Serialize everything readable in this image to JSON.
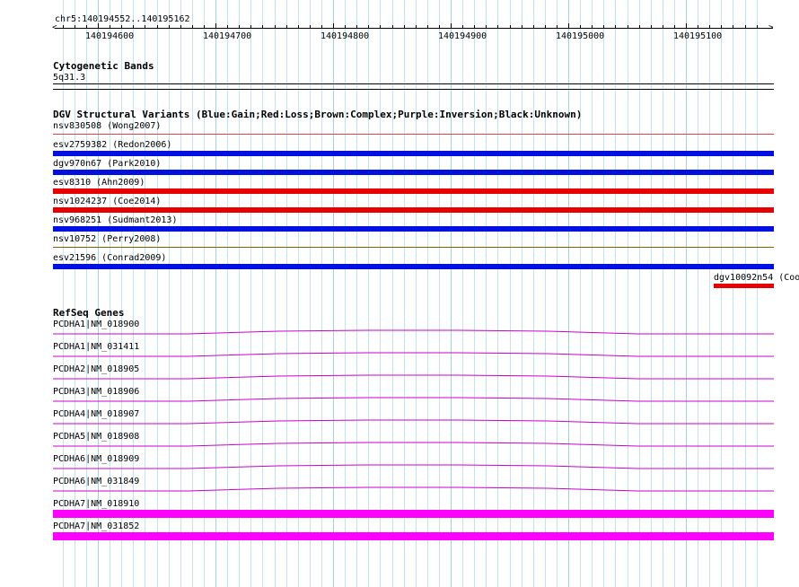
{
  "ruler": {
    "range_label": "chr5:140194552..140195162",
    "ticks": [
      "140194600",
      "140194700",
      "140194800",
      "140194900",
      "140195000",
      "140195100"
    ]
  },
  "cytoband": {
    "title": "Cytogenetic Bands",
    "band": "5q31.3"
  },
  "dgv": {
    "title": "DGV Structural Variants (Blue:Gain;Red:Loss;Brown:Complex;Purple:Inversion;Black:Unknown)",
    "variants": [
      {
        "label": "nsv830508 (Wong2007)",
        "color": "#e04040",
        "kind": "thin"
      },
      {
        "label": "esv2759382 (Redon2006)",
        "color": "#0010e0",
        "kind": "thick"
      },
      {
        "label": "dgv970n67 (Park2010)",
        "color": "#0010e0",
        "kind": "thick"
      },
      {
        "label": "esv8310 (Ahn2009)",
        "color": "#e80000",
        "kind": "thick"
      },
      {
        "label": "nsv1024237 (Coe2014)",
        "color": "#e80000",
        "kind": "thick"
      },
      {
        "label": "nsv968251 (Sudmant2013)",
        "color": "#0010e0",
        "kind": "thick"
      },
      {
        "label": "nsv10752 (Perry2008)",
        "color": "#806000",
        "kind": "thin"
      },
      {
        "label": "esv21596 (Conrad2009)",
        "color": "#0010e0",
        "kind": "thick"
      }
    ],
    "edge_variant": {
      "label": "dgv10092n54 (Coo",
      "color": "#e80000"
    }
  },
  "refseq": {
    "title": "RefSeq Genes",
    "color": "#cc00cc",
    "highlight_color": "#ff00ff",
    "genes": [
      {
        "label": "PCDHA1|NM_018900",
        "style": "wave"
      },
      {
        "label": "PCDHA1|NM_031411",
        "style": "wave"
      },
      {
        "label": "PCDHA2|NM_018905",
        "style": "wave"
      },
      {
        "label": "PCDHA3|NM_018906",
        "style": "wave"
      },
      {
        "label": "PCDHA4|NM_018907",
        "style": "wave"
      },
      {
        "label": "PCDHA5|NM_018908",
        "style": "wave"
      },
      {
        "label": "PCDHA6|NM_018909",
        "style": "wave"
      },
      {
        "label": "PCDHA6|NM_031849",
        "style": "wave"
      },
      {
        "label": "PCDHA7|NM_018910",
        "style": "thick"
      },
      {
        "label": "PCDHA7|NM_031852",
        "style": "thick"
      }
    ]
  }
}
